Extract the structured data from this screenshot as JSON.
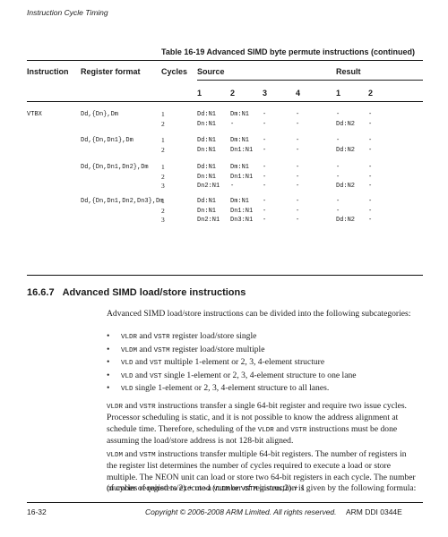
{
  "header": {
    "running_title": "Instruction Cycle Timing"
  },
  "table": {
    "caption": "Table 16-19 Advanced SIMD byte permute instructions (continued)",
    "headers": {
      "instruction": "Instruction",
      "register_format": "Register format",
      "cycles": "Cycles",
      "source": "Source",
      "result": "Result"
    },
    "subheaders": {
      "source": [
        "1",
        "2",
        "3",
        "4"
      ],
      "result": [
        "1",
        "2"
      ]
    },
    "instruction": "VTBX",
    "groups": [
      {
        "format": "Dd,{Dn},Dm",
        "rows": [
          {
            "cycle": "1",
            "s1": "Dd:N1",
            "s2": "Dm:N1",
            "s3": "-",
            "s4": "-",
            "r1": "-",
            "r2": "-"
          },
          {
            "cycle": "2",
            "s1": "Dn:N1",
            "s2": "-",
            "s3": "-",
            "s4": "-",
            "r1": "Dd:N2",
            "r2": "-"
          }
        ]
      },
      {
        "format": "Dd,{Dn,Dn1},Dm",
        "rows": [
          {
            "cycle": "1",
            "s1": "Dd:N1",
            "s2": "Dm:N1",
            "s3": "-",
            "s4": "-",
            "r1": "-",
            "r2": "-"
          },
          {
            "cycle": "2",
            "s1": "Dn:N1",
            "s2": "Dn1:N1",
            "s3": "-",
            "s4": "-",
            "r1": "Dd:N2",
            "r2": "-"
          }
        ]
      },
      {
        "format": "Dd,{Dn,Dn1,Dn2},Dm",
        "rows": [
          {
            "cycle": "1",
            "s1": "Dd:N1",
            "s2": "Dm:N1",
            "s3": "-",
            "s4": "-",
            "r1": "-",
            "r2": "-"
          },
          {
            "cycle": "2",
            "s1": "Dn:N1",
            "s2": "Dn1:N1",
            "s3": "-",
            "s4": "-",
            "r1": "-",
            "r2": "-"
          },
          {
            "cycle": "3",
            "s1": "Dn2:N1",
            "s2": "-",
            "s3": "-",
            "s4": "-",
            "r1": "Dd:N2",
            "r2": "-"
          }
        ]
      },
      {
        "format": "Dd,{Dn,Dn1,Dn2,Dn3},Dm",
        "rows": [
          {
            "cycle": "1",
            "s1": "Dd:N1",
            "s2": "Dm:N1",
            "s3": "-",
            "s4": "-",
            "r1": "-",
            "r2": "-"
          },
          {
            "cycle": "2",
            "s1": "Dn:N1",
            "s2": "Dn1:N1",
            "s3": "-",
            "s4": "-",
            "r1": "-",
            "r2": "-"
          },
          {
            "cycle": "3",
            "s1": "Dn2:N1",
            "s2": "Dn3:N1",
            "s3": "-",
            "s4": "-",
            "r1": "Dd:N2",
            "r2": "-"
          }
        ]
      }
    ]
  },
  "section": {
    "number": "16.6.7",
    "title": "Advanced SIMD load/store instructions",
    "intro": "Advanced SIMD load/store instructions can be divided into the following subcategories:",
    "bullets": [
      {
        "code1": "VLDR",
        "and": " and ",
        "code2": "VSTR",
        "text": " register load/store single"
      },
      {
        "code1": "VLDM",
        "and": " and ",
        "code2": "VSTM",
        "text": " register load/store multiple"
      },
      {
        "code1": "VLD",
        "and": " and ",
        "code2": "VST",
        "text": " multiple 1-element or 2, 3, 4-element structure"
      },
      {
        "code1": "VLD",
        "and": " and ",
        "code2": "VST",
        "text": " single 1-element or 2, 3, 4-element structure to one lane"
      },
      {
        "code1": "VLD",
        "and": "",
        "code2": "",
        "text": " single 1-element or 2, 3, 4-element structure to all lanes."
      }
    ],
    "para1": {
      "c1": "VLDR",
      "t1": " and ",
      "c2": "VSTR",
      "t2": " instructions transfer a single 64-bit register and require two issue cycles. Processor scheduling is static, and it is not possible to know the address alignment at schedule time. Therefore, scheduling of the ",
      "c3": "VLDR",
      "t3": " and ",
      "c4": "VSTR",
      "t4": " instructions must be done assuming the load/store address is not 128-bit aligned."
    },
    "para2": {
      "c1": "VLDM",
      "t1": " and ",
      "c2": "VSTM",
      "t2": " instructions transfer multiple 64-bit registers. The number of registers in the register list determines the number of cycles required to execute a load or store multiple. The NEON unit can load or store two 64-bit registers in each cycle. The number of cycles required to execute a ",
      "c3": "VLDM",
      "t3": " or ",
      "c4": "VSTM",
      "t4": " instruction is given by the following formula:"
    },
    "formula": "(number of registers/2) + mod (number of registers,2) + 1"
  },
  "footer": {
    "page": "16-32",
    "copyright": "Copyright © 2006-2008 ARM Limited. All rights reserved.",
    "doc_id": "ARM DDI 0344E"
  }
}
